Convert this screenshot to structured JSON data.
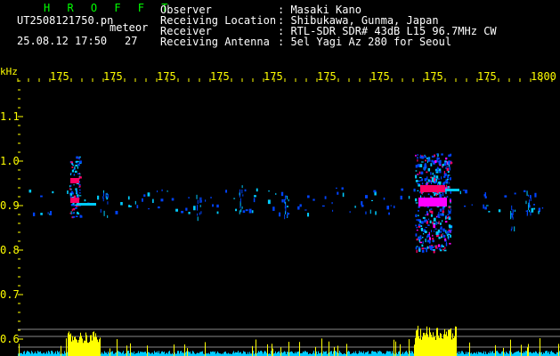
{
  "header": {
    "brand": "H R O F F T",
    "filename": "UT2508121750.pn",
    "mode": "meteor",
    "datetime": "25.08.12 17:50",
    "count": "27"
  },
  "info": [
    {
      "label": "Observer",
      "value": ": Masaki Kano"
    },
    {
      "label": "Receiving Location",
      "value": ": Shibukawa, Gunma, Japan"
    },
    {
      "label": "Receiver",
      "value": ": RTL-SDR SDR# 43dB L15 96.7MHz CW"
    },
    {
      "label": "Receiving Antenna",
      "value": ": 5el Yagi Az 280 for Seoul"
    }
  ],
  "axes": {
    "y_unit": "kHz",
    "x_ticks": [
      "175",
      "175",
      "175",
      "175",
      "175",
      "175",
      "175",
      "175",
      "175",
      "1800"
    ],
    "y_ticks": [
      "1.1",
      "1.0",
      "0.9",
      "0.8",
      "0.7",
      "0.6"
    ]
  },
  "colors": {
    "label": "#ffff00",
    "text": "#ffffff",
    "brand": "#00ff00",
    "background": "#000000",
    "signal_weak": "#0044ff",
    "signal_mid": "#00ccff",
    "signal_strong": "#ff0066",
    "signal_peak": "#ff00ff",
    "power_bar": "#ffff00",
    "grid_line": "#888888"
  }
}
